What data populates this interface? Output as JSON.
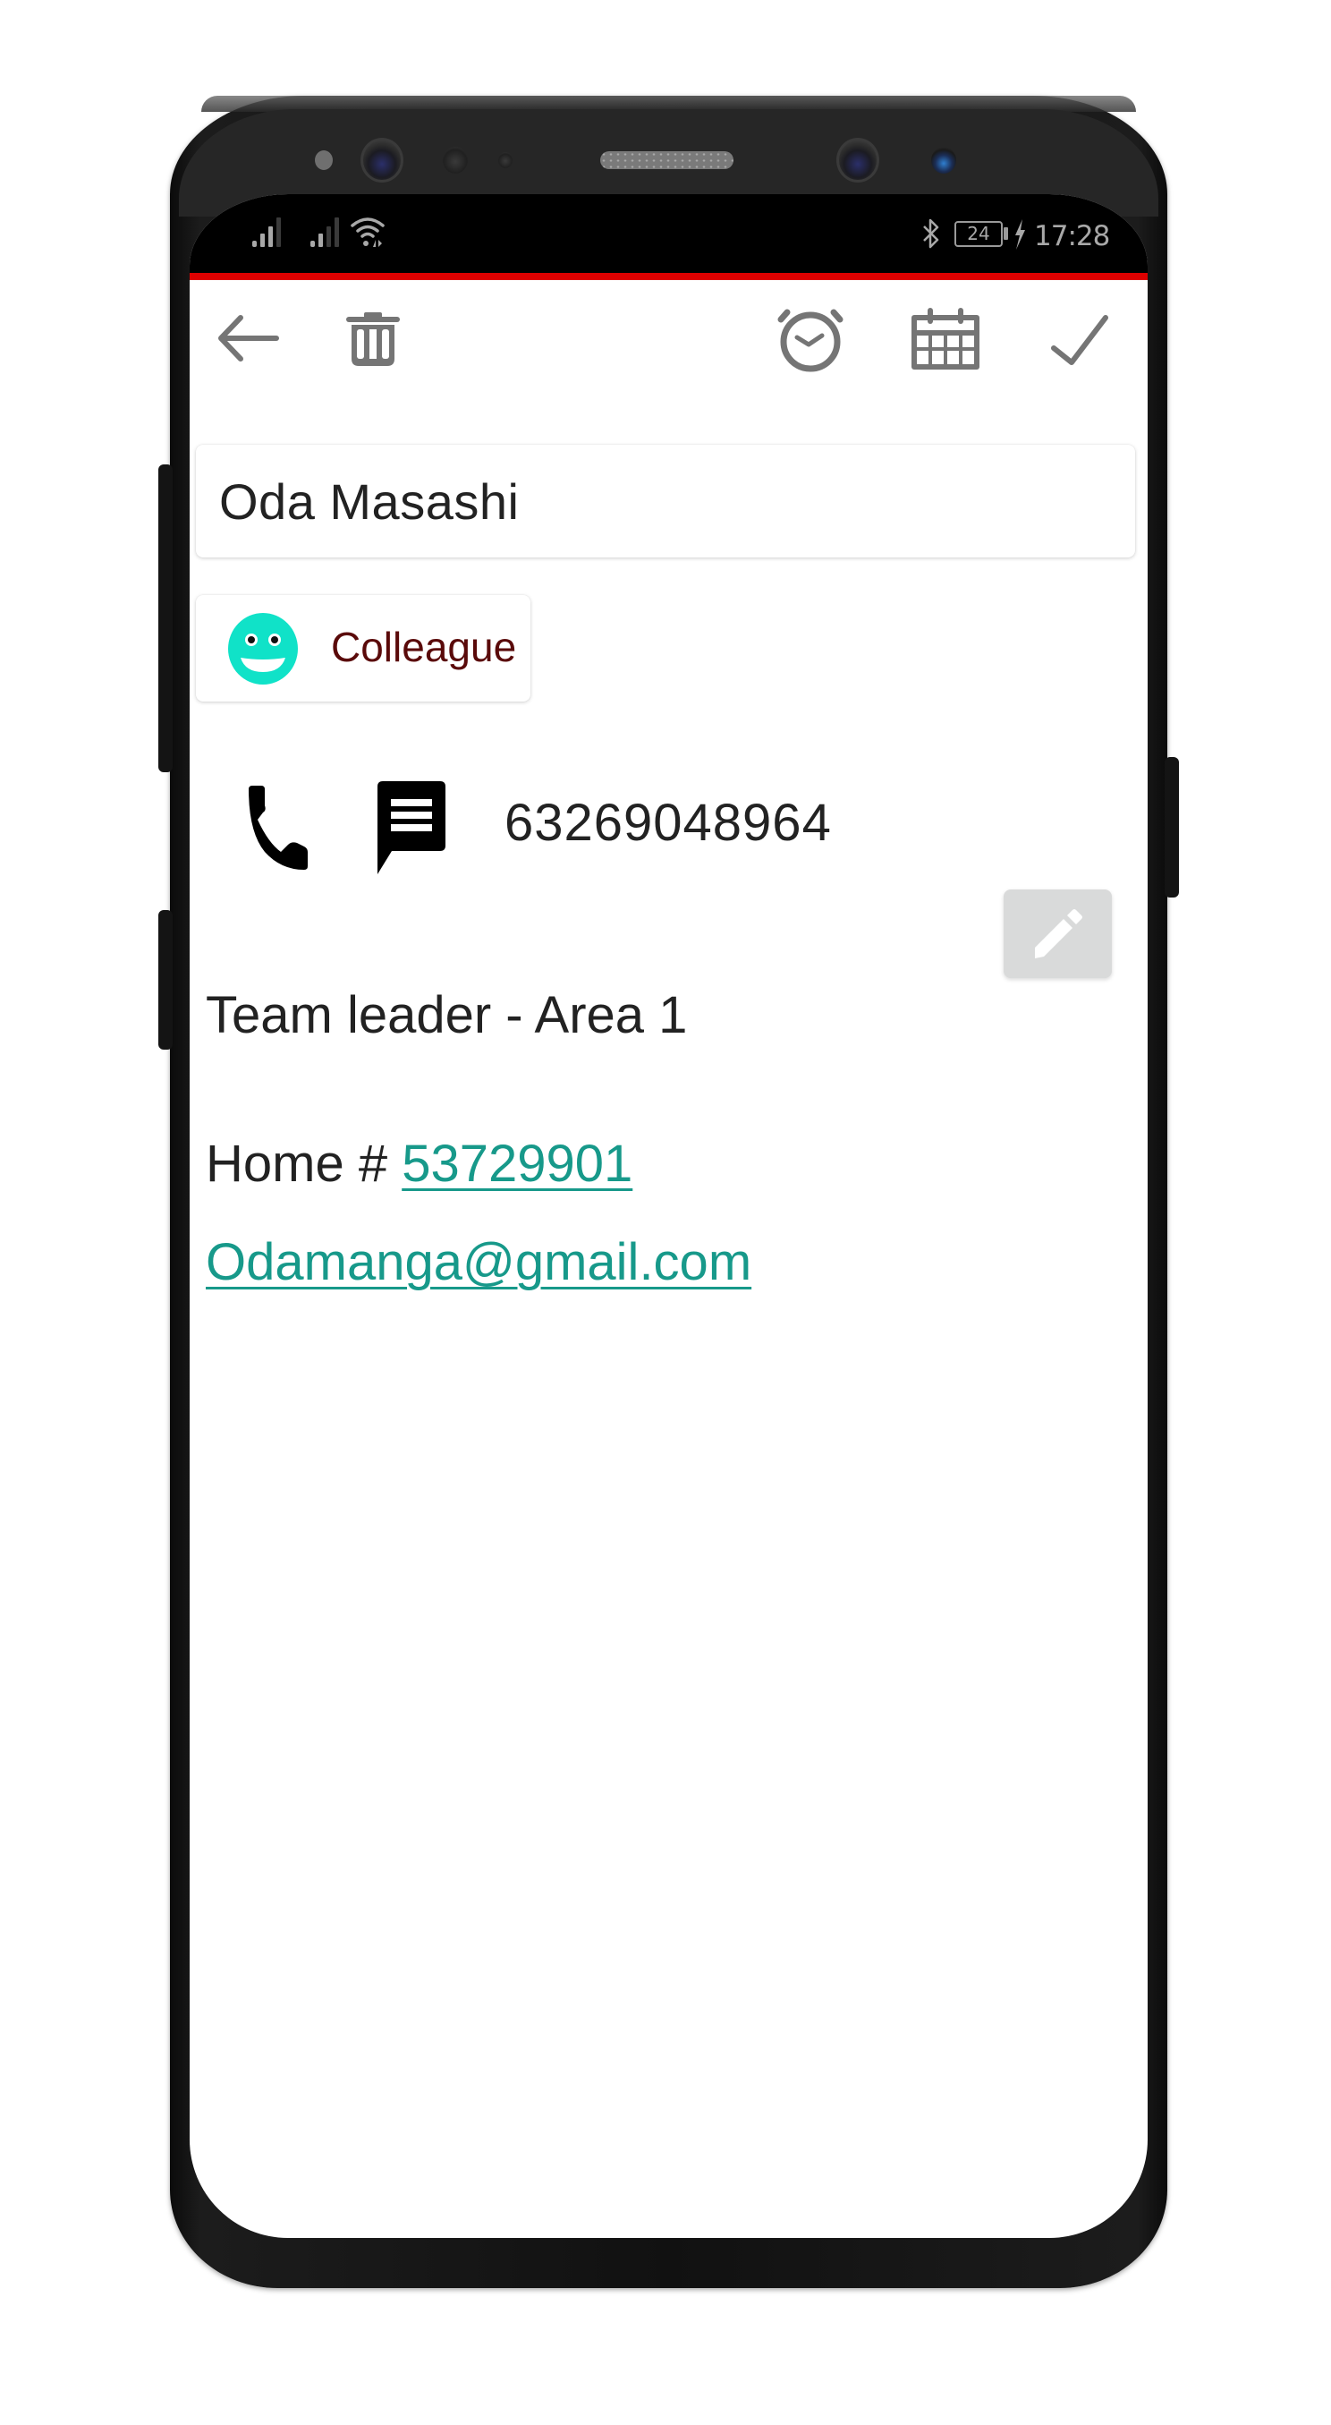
{
  "colors": {
    "accent_red": "#dd0000",
    "toolbar_icon": "#757575",
    "text_primary": "#222222",
    "chip_label": "#5a0a0a",
    "smiley": "#10e2c8",
    "link_teal": "#17998a",
    "edit_button_bg": "#d9dada",
    "status_icon": "#a8a8a8"
  },
  "status_bar": {
    "signal_icons": [
      "signal-sim1-icon",
      "signal-sim2-icon"
    ],
    "wifi_icon": "wifi-icon",
    "bluetooth_icon": "bluetooth-icon",
    "battery_level": "24",
    "charging_icon": "charging-bolt-icon",
    "time": "17:28"
  },
  "toolbar": {
    "left": [
      {
        "name": "back",
        "icon": "arrow-left-icon"
      },
      {
        "name": "delete",
        "icon": "trash-icon"
      }
    ],
    "right": [
      {
        "name": "reminder",
        "icon": "alarm-clock-icon"
      },
      {
        "name": "calendar",
        "icon": "calendar-icon"
      },
      {
        "name": "save",
        "icon": "check-icon"
      }
    ]
  },
  "contact": {
    "name": "Oda Masashi",
    "category": {
      "label": "Colleague",
      "icon": "smiley-face-icon"
    },
    "phone": {
      "number": "63269048964",
      "call_icon": "phone-icon",
      "message_icon": "message-icon"
    },
    "edit_icon": "pencil-icon",
    "notes": {
      "line1": "Team leader - Area 1",
      "home_prefix": "Home # ",
      "home_number": "53729901",
      "email": "Odamanga@gmail.com"
    }
  }
}
